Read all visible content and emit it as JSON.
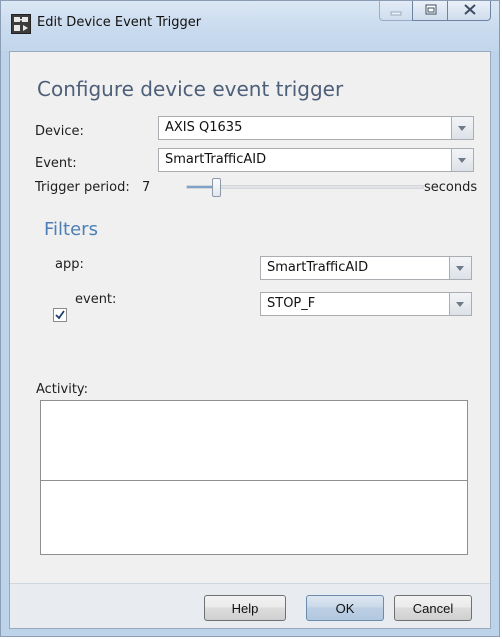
{
  "window": {
    "title": "Edit Device Event Trigger",
    "icon": "device-trigger-app-icon",
    "caption_buttons": [
      "minimize-icon",
      "maximize-icon",
      "close-icon"
    ]
  },
  "form": {
    "heading": "Configure device event trigger",
    "device_label": "Device:",
    "device_value": "AXIS Q1635",
    "event_label": "Event:",
    "event_value": "SmartTrafficAID",
    "trigger_period_label": "Trigger period:",
    "trigger_period_value": "7",
    "trigger_period_unit": "seconds",
    "trigger_period_fraction": 0.13
  },
  "filters": {
    "heading": "Filters",
    "rows": [
      {
        "label": "app:",
        "value": "SmartTrafficAID",
        "checkbox": false
      },
      {
        "label": "event:",
        "value": "STOP_F",
        "checkbox": true,
        "checked": true
      }
    ]
  },
  "activity": {
    "label": "Activity:"
  },
  "buttons": {
    "help": "Help",
    "ok": "OK",
    "cancel": "Cancel"
  },
  "colors": {
    "heading": "#4e6079",
    "filters_heading": "#4b7fb5",
    "window_frame": "#bcd3ea",
    "client_bg": "#f0f0f0"
  }
}
